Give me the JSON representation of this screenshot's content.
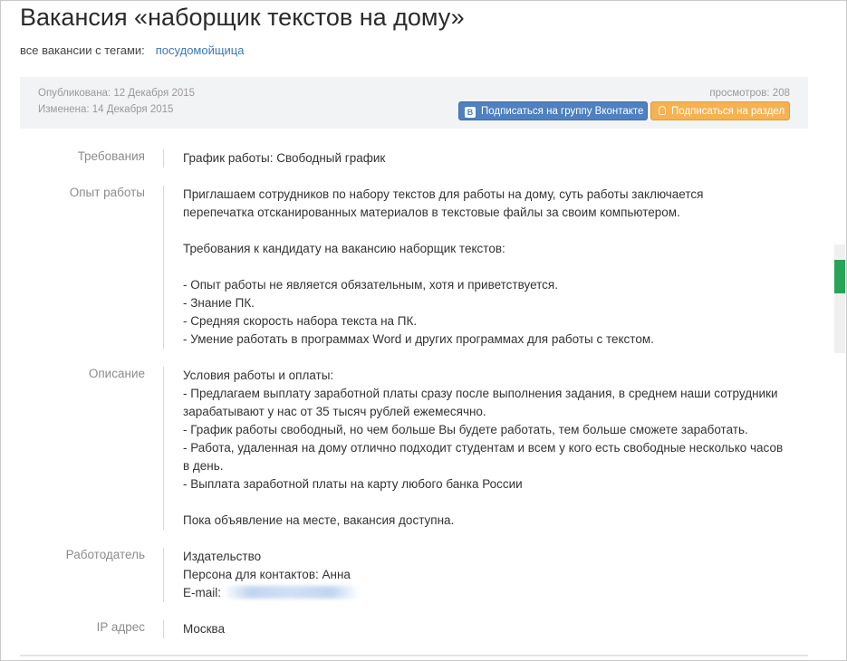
{
  "header": {
    "title": "Вакансия «наборщик текстов на дому»",
    "tags_prefix": "все вакансии с тегами:",
    "tag": "посудомойщица"
  },
  "infobar": {
    "published": "Опубликована: 12 Декабря 2015",
    "modified": "Изменена: 14 Декабря 2015",
    "views": "просмотров: 208",
    "vk_button": "Подписаться на группу Вконтакте",
    "subscribe_button": "Подписаться на раздел",
    "vk_icon_letter": "В"
  },
  "colors": {
    "accent_link": "#3a78b8",
    "vk_button": "#4f80c0",
    "subscribe_button": "#f5b251",
    "scroll_marker": "#27a35a"
  },
  "fields": {
    "requirements": {
      "label": "Требования",
      "lines": [
        "График работы: Свободный график"
      ]
    },
    "experience": {
      "label": "Опыт работы",
      "lines": [
        "Приглашаем сотрудников по набору текстов для работы на дому, суть работы заключается",
        "перепечатка отсканированных материалов в текстовые файлы за своим компьютером.",
        "",
        "Требования к кандидату на вакансию наборщик текстов:",
        "",
        "- Опыт работы не является обязательным, хотя и приветствуется.",
        "- Знание ПК.",
        "- Средняя скорость набора текста на ПК.",
        "- Умение работать в программах Word и других программах для работы с текстом."
      ]
    },
    "description": {
      "label": "Описание",
      "lines": [
        "Условия работы и оплаты:",
        "- Предлагаем выплату заработной платы сразу после выполнения задания, в среднем наши сотрудники",
        "зарабатывают у нас от 35 тысяч рублей ежемесячно.",
        "- График работы свободный, но чем больше Вы будете работать, тем больше сможете заработать.",
        "- Работа, удаленная на дому отлично подходит студентам и всем у кого есть свободные несколько часов",
        "в день.",
        "- Выплата заработной платы на карту любого банка России",
        "",
        "Пока объявление на месте, вакансия доступна."
      ]
    },
    "employer": {
      "label": "Работодатель",
      "company": "Издательство",
      "contact": "Персона для контактов: Анна",
      "email_label": "E-mail:"
    },
    "ip": {
      "label": "IP адрес",
      "value": "Москва"
    }
  }
}
